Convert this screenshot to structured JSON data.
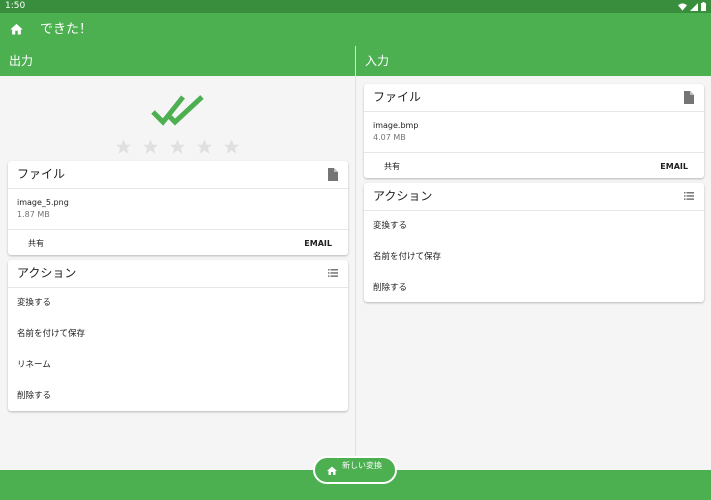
{
  "status": {
    "time": "1:50"
  },
  "appbar": {
    "title": "できた！",
    "home_icon": "home-icon"
  },
  "output": {
    "header": "出力",
    "rating_stars": 0,
    "file": {
      "title": "ファイル",
      "name": "image_5.png",
      "size": "1.87 MB",
      "share": "共有",
      "email": "EMAIL"
    },
    "actions": {
      "title": "アクション",
      "items": [
        "変換する",
        "名前を付けて保存",
        "リネーム",
        "削除する"
      ]
    }
  },
  "input": {
    "header": "入力",
    "file": {
      "title": "ファイル",
      "name": "image.bmp",
      "size": "4.07 MB",
      "share": "共有",
      "email": "EMAIL"
    },
    "actions": {
      "title": "アクション",
      "items": [
        "変換する",
        "名前を付けて保存",
        "削除する"
      ]
    }
  },
  "fab": {
    "label": "新しい変換"
  },
  "colors": {
    "primary": "#4caf50",
    "statusbar": "#388e3c",
    "star": "#e0e0e0"
  }
}
